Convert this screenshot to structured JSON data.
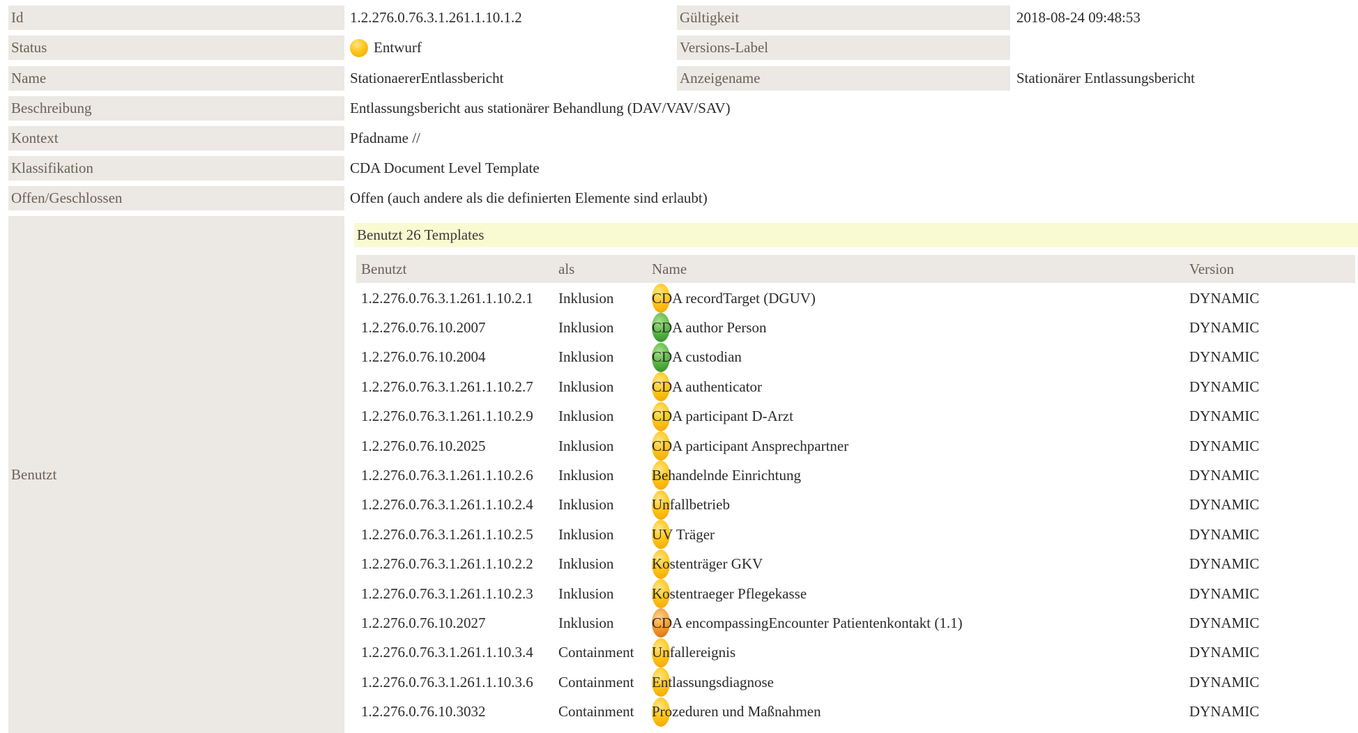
{
  "fields": {
    "id_label": "Id",
    "id_value": "1.2.276.0.76.3.1.261.1.10.1.2",
    "validity_label": "Gültigkeit",
    "validity_value": "2018-08-24 09:48:53",
    "status_label": "Status",
    "status_value": "Entwurf",
    "version_label": "Versions-Label",
    "name_label": "Name",
    "name_value": "StationaererEntlassbericht",
    "display_label": "Anzeigename",
    "display_value": "Stationärer Entlassungsbericht",
    "description_label": "Beschreibung",
    "description_value": "Entlassungsbericht aus stationärer Behandlung (DAV/VAV/SAV)",
    "context_label": "Kontext",
    "context_value": "Pfadname //",
    "classification_label": "Klassifikation",
    "classification_value": "CDA Document Level Template",
    "open_label": "Offen/Geschlossen",
    "open_value": "Offen (auch andere als die definierten Elemente sind erlaubt)",
    "uses_label": "Benutzt"
  },
  "uses": {
    "title": "Benutzt 26 Templates",
    "headers": {
      "used": "Benutzt",
      "as": "als",
      "name": "Name",
      "version": "Version"
    },
    "rows": [
      {
        "id": "1.2.276.0.76.3.1.261.1.10.2.1",
        "as": "Inklusion",
        "status": "yellow",
        "name": "CDA recordTarget (DGUV)",
        "version": "DYNAMIC"
      },
      {
        "id": "1.2.276.0.76.10.2007",
        "as": "Inklusion",
        "status": "green",
        "name": "CDA author Person",
        "version": "DYNAMIC"
      },
      {
        "id": "1.2.276.0.76.10.2004",
        "as": "Inklusion",
        "status": "green",
        "name": "CDA custodian",
        "version": "DYNAMIC"
      },
      {
        "id": "1.2.276.0.76.3.1.261.1.10.2.7",
        "as": "Inklusion",
        "status": "yellow",
        "name": "CDA authenticator",
        "version": "DYNAMIC"
      },
      {
        "id": "1.2.276.0.76.3.1.261.1.10.2.9",
        "as": "Inklusion",
        "status": "yellow",
        "name": "CDA participant D-Arzt",
        "version": "DYNAMIC"
      },
      {
        "id": "1.2.276.0.76.10.2025",
        "as": "Inklusion",
        "status": "yellow",
        "name": "CDA participant Ansprechpartner",
        "version": "DYNAMIC"
      },
      {
        "id": "1.2.276.0.76.3.1.261.1.10.2.6",
        "as": "Inklusion",
        "status": "yellow",
        "name": "Behandelnde Einrichtung",
        "version": "DYNAMIC"
      },
      {
        "id": "1.2.276.0.76.3.1.261.1.10.2.4",
        "as": "Inklusion",
        "status": "yellow",
        "name": "Unfallbetrieb",
        "version": "DYNAMIC"
      },
      {
        "id": "1.2.276.0.76.3.1.261.1.10.2.5",
        "as": "Inklusion",
        "status": "yellow",
        "name": "UV Träger",
        "version": "DYNAMIC"
      },
      {
        "id": "1.2.276.0.76.3.1.261.1.10.2.2",
        "as": "Inklusion",
        "status": "yellow",
        "name": "Kostenträger GKV",
        "version": "DYNAMIC"
      },
      {
        "id": "1.2.276.0.76.3.1.261.1.10.2.3",
        "as": "Inklusion",
        "status": "yellow",
        "name": "Kostentraeger Pflegekasse",
        "version": "DYNAMIC"
      },
      {
        "id": "1.2.276.0.76.10.2027",
        "as": "Inklusion",
        "status": "orange",
        "name": "CDA encompassingEncounter Patientenkontakt (1.1)",
        "version": "DYNAMIC"
      },
      {
        "id": "1.2.276.0.76.3.1.261.1.10.3.4",
        "as": "Containment",
        "status": "yellow",
        "name": "Unfallereignis",
        "version": "DYNAMIC"
      },
      {
        "id": "1.2.276.0.76.3.1.261.1.10.3.6",
        "as": "Containment",
        "status": "yellow",
        "name": "Entlassungsdiagnose",
        "version": "DYNAMIC"
      },
      {
        "id": "1.2.276.0.76.10.3032",
        "as": "Containment",
        "status": "yellow",
        "name": "Prozeduren und Maßnahmen",
        "version": "DYNAMIC"
      }
    ]
  }
}
